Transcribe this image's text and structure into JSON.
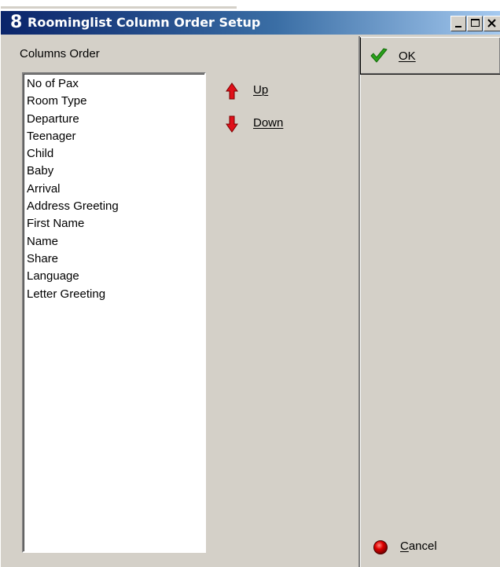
{
  "window": {
    "title": "Roominglist Column Order Setup",
    "app_icon_glyph": "8",
    "controls": [
      "minimize",
      "maximize",
      "close"
    ]
  },
  "columns": {
    "label": "Columns Order",
    "items": [
      "No of Pax",
      "Room Type",
      "Departure",
      "Teenager",
      "Child",
      "Baby",
      "Arrival",
      "Address Greeting",
      "First Name",
      "Name",
      "Share",
      "Language",
      "Letter Greeting"
    ]
  },
  "move": {
    "up_label": "Up",
    "down_label": "Down",
    "up_icon": "red-arrow-up-icon",
    "down_icon": "red-arrow-down-icon"
  },
  "actions": {
    "ok_label": "OK",
    "ok_icon": "green-check-icon",
    "cancel_label_first": "C",
    "cancel_label_rest": "ancel",
    "cancel_icon": "red-circle-icon"
  },
  "colors": {
    "title_bar_start": "#0a246a",
    "title_bar_end": "#a6caf0",
    "face": "#d4d0c8",
    "arrow_red": "#e0101a",
    "check_green": "#2aa21a"
  }
}
